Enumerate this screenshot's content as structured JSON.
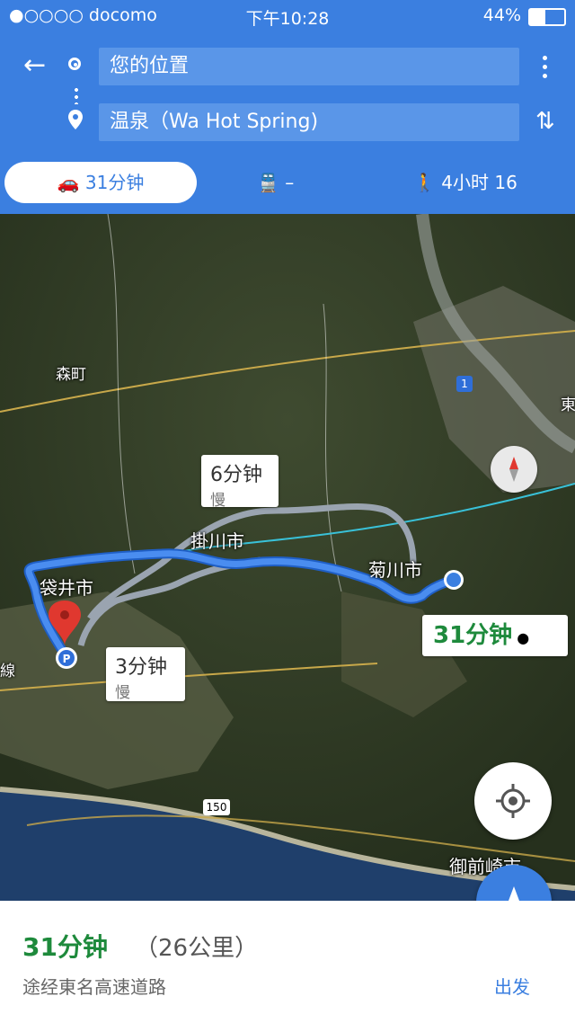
{
  "status_bar": {
    "carrier": "●○○○○ docomo",
    "time": "下午10:28",
    "battery_text": "44%",
    "battery_level": 0.44
  },
  "directions": {
    "origin": "您的位置",
    "destination": "温泉（Wa Hot Spring)"
  },
  "modes": {
    "car": "31分钟",
    "transit": "–",
    "walk": "4小时 16"
  },
  "map_labels": {
    "mori": "森町",
    "fukuroi": "袋井市",
    "kakegawa": "掛川市",
    "kikugawa": "菊川市",
    "omaezaki": "御前崎市",
    "road1": "1",
    "road150": "150",
    "east": "東",
    "line": "線"
  },
  "callouts": {
    "alt1_time": "6分钟",
    "alt1_note": "慢",
    "alt2_time": "3分钟",
    "alt2_note": "慢",
    "main_time": "31分钟"
  },
  "route_summary": {
    "duration": "31分钟",
    "distance": "（26公里）",
    "via": "途经東名高速道路",
    "start_label": "出发"
  },
  "colors": {
    "header": "#3b7fe0",
    "route": "#4a8df0",
    "duration_green": "#1e8a3c"
  }
}
